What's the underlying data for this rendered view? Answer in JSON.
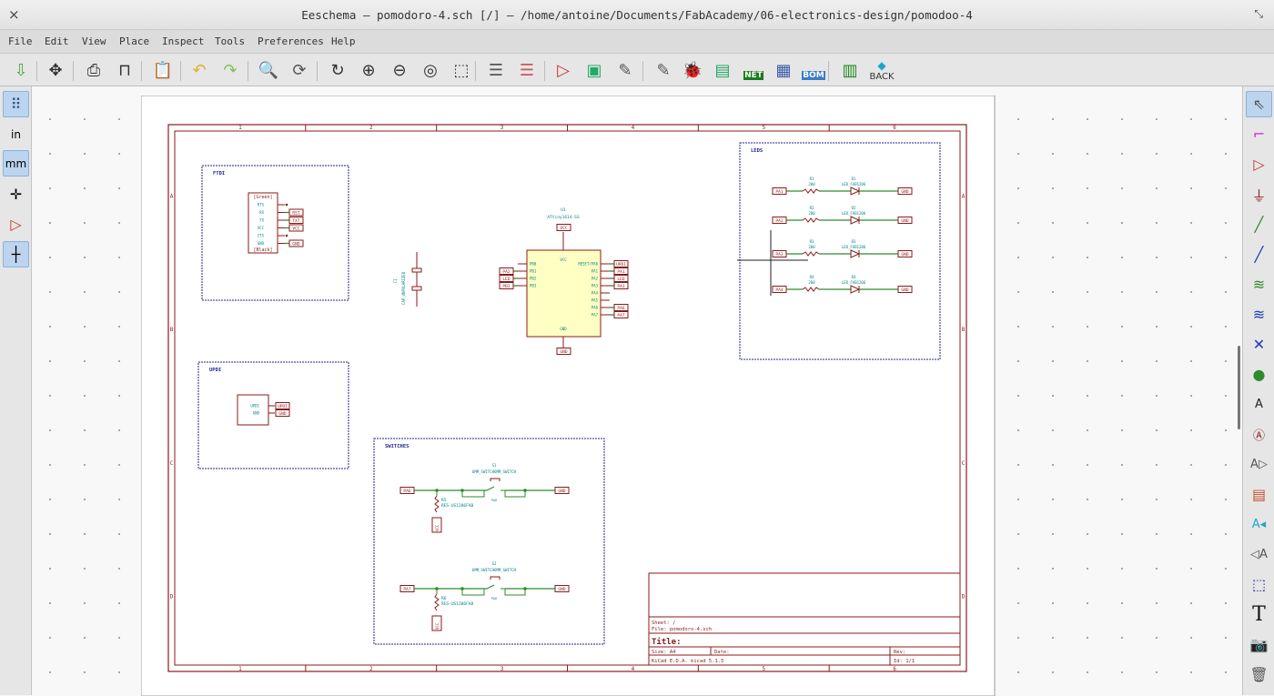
{
  "window": {
    "title": "Eeschema — pomodoro-4.sch [/] — /home/antoine/Documents/FabAcademy/06-electronics-design/pomodoo-4",
    "close": "×",
    "restore": "⤡"
  },
  "menu": [
    "File",
    "Edit",
    "View",
    "Place",
    "Inspect",
    "Tools",
    "Preferences",
    "Help"
  ],
  "toolbar": {
    "back_label": "BACK",
    "net_label": "NET",
    "bom_label": "BOM",
    "icons": [
      "save-icon",
      "page-settings-icon",
      "print-icon",
      "plot-icon",
      "paste-icon",
      "undo-icon",
      "redo-icon",
      "find-icon",
      "find-replace-icon",
      "redraw-icon",
      "zoom-in-icon",
      "zoom-out-icon",
      "zoom-fit-icon",
      "zoom-selection-icon",
      "hierarchy-navigator-icon",
      "leave-sheet-icon",
      "library-editor-icon",
      "library-browser-icon",
      "annotate-icon",
      "edit-fields-icon",
      "erc-icon",
      "assign-footprints-icon",
      "netlist-icon",
      "bom-grid-icon",
      "bom-icon",
      "pcbnew-icon",
      "back-annotate-icon"
    ]
  },
  "left_toolbar": {
    "units_in": "in",
    "units_mm": "mm",
    "icons": [
      "grid-icon",
      "inches-icon",
      "millimeters-icon",
      "cursor-crosshair-icon",
      "hidden-pins-icon",
      "wire-angle-icon"
    ]
  },
  "right_toolbar": {
    "icons": [
      "select-icon",
      "highlight-net-icon",
      "add-symbol-icon",
      "add-power-icon",
      "add-wire-icon",
      "add-bus-icon",
      "wire-to-bus-entry-icon",
      "bus-to-bus-entry-icon",
      "no-connect-icon",
      "add-junction-icon",
      "add-net-label-icon",
      "add-global-label-icon",
      "add-hier-label-icon",
      "add-sheet-icon",
      "import-sheet-pin-icon",
      "add-sheet-pin-icon",
      "add-graphic-lines-icon",
      "add-text-icon",
      "add-image-icon",
      "delete-icon"
    ]
  },
  "colors": {
    "border": "#8b1a1a",
    "wire": "#2e8b2e",
    "label_text": "#008484",
    "sheet_fill": "#ffffc4",
    "junction": "#2e8b2e"
  },
  "schematic": {
    "borders": {
      "rows": [
        "A",
        "B",
        "C",
        "D"
      ],
      "cols": [
        "1",
        "2",
        "3",
        "4",
        "5",
        "6"
      ]
    },
    "ftdi": {
      "title": "FTDI",
      "connector": {
        "top": "[Green]",
        "bottom": "[Black]",
        "pins": [
          "RTS",
          "RX",
          "TX",
          "VCC",
          "CTS",
          "GND"
        ]
      },
      "labels": [
        "RST",
        "TXT",
        "VCC",
        "GND"
      ]
    },
    "updi": {
      "title": "UPDI",
      "pins": [
        "UPDI",
        "GND"
      ],
      "labels": [
        "UPDI",
        "GND"
      ]
    },
    "cap": {
      "ref": "C1",
      "value": "CAP_UNPOLARIZED"
    },
    "mcu": {
      "ref": "U1",
      "value": "ATtiny1614-SS",
      "left_pins": [
        "PB0",
        "PB1",
        "PB2",
        "PB3"
      ],
      "right_pins": [
        "RESET/PA0",
        "PA1",
        "PA2",
        "PA3",
        "PA4",
        "PA5",
        "PA6",
        "PA7"
      ],
      "top_pin": "VCC",
      "bottom_pin": "GND",
      "left_labels": [
        "PA2",
        "LED",
        "PB3"
      ],
      "right_labels": [
        "UPDI",
        "PA1",
        "LED",
        "PA3",
        "PA6",
        "PA7"
      ],
      "vcc_label": "VCC",
      "gnd_label": "GND"
    },
    "leds": {
      "title": "LEDS",
      "rows": [
        {
          "r": "R1",
          "rv": "200",
          "d": "D1",
          "dv": "LED_FAB1206",
          "in": "PA1"
        },
        {
          "r": "R2",
          "rv": "200",
          "d": "D2",
          "dv": "LED_FAB1206",
          "in": "PA2"
        },
        {
          "r": "R3",
          "rv": "200",
          "d": "D3",
          "dv": "LED_FAB1206",
          "in": "PA3"
        },
        {
          "r": "R4",
          "rv": "200",
          "d": "D4",
          "dv": "LED_FAB1206",
          "in": "PA4"
        }
      ],
      "gnd": "GND"
    },
    "switches": {
      "title": "SWITCHES",
      "rows": [
        {
          "s": "S1",
          "sv": "6MM_SWITCH6MM_SWITCH",
          "in": "PA6",
          "r": "R5",
          "rv": "RES-US1206FAB",
          "out": "GND",
          "pwr": "VCC"
        },
        {
          "s": "S2",
          "sv": "6MM_SWITCH6MM_SWITCH",
          "in": "PA7",
          "r": "R6",
          "rv": "RES-US1206FAB",
          "out": "GND",
          "pwr": "VCC"
        }
      ],
      "pin_label": "PAD"
    },
    "title_block": {
      "sheet": "Sheet: /",
      "file": "File: pomodoro-4.sch",
      "title": "Title:",
      "size": "Size: A4",
      "date": "Date:",
      "rev": "Rev:",
      "kicad": "KiCad E.D.A.  kicad 5.1.5",
      "id": "Id: 1/1"
    }
  }
}
